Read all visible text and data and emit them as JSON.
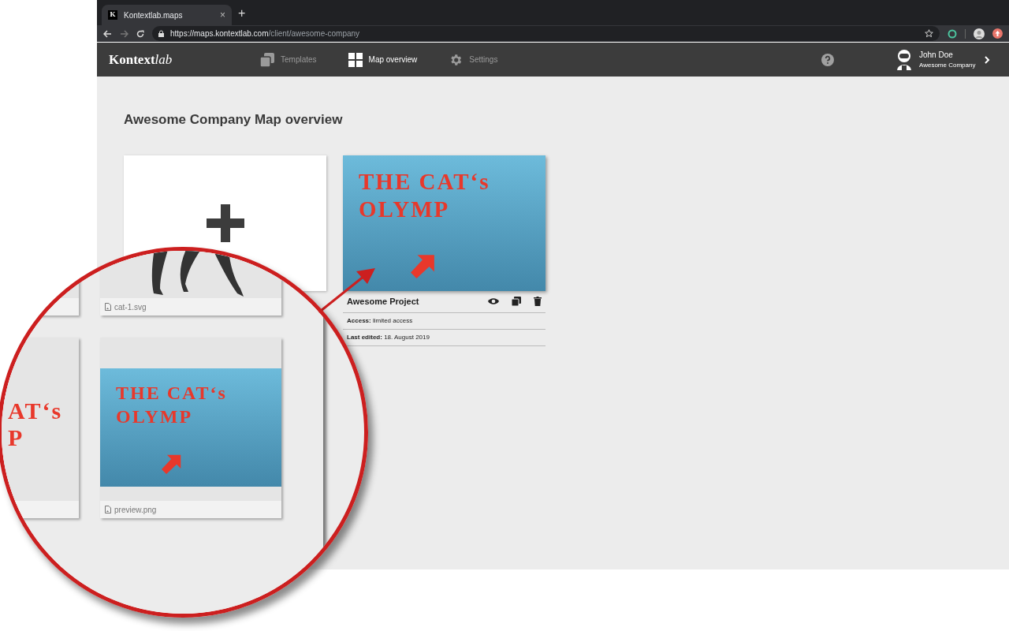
{
  "browser": {
    "tab": {
      "favicon": "K",
      "title": "Kontextlab.maps",
      "close": "×",
      "selected": true
    },
    "new_tab": "+",
    "forward_disabled": true,
    "url_host": "https://maps.kontextlab.com",
    "url_path": "/client/awesome-company"
  },
  "app_header": {
    "logo_main": "Kontext",
    "logo_italic": "lab",
    "nav": [
      {
        "kind": "templates",
        "label": "Templates",
        "selected": false
      },
      {
        "kind": "overview",
        "label": "Map overview",
        "selected": true
      },
      {
        "kind": "settings",
        "label": "Settings",
        "selected": false
      }
    ],
    "user": {
      "name": "John Doe",
      "company": "Awesome Company"
    }
  },
  "page": {
    "title": "Awesome Company Map overview",
    "project": {
      "preview_lines": [
        "THE CAT‘s",
        "OLYMP"
      ],
      "name": "Awesome Project",
      "access": "**Access:** limited access",
      "edited": "**Last edited:** 18. August 2019"
    }
  },
  "magnifier": {
    "files": [
      {
        "kind": "cat",
        "name": "cat-1.svg"
      },
      {
        "kind": "preview",
        "name": "preview.png",
        "preview_lines": [
          "THE CAT‘s",
          "OLYMP"
        ]
      }
    ],
    "partial_lines": [
      "AT‘s",
      "P"
    ]
  }
}
